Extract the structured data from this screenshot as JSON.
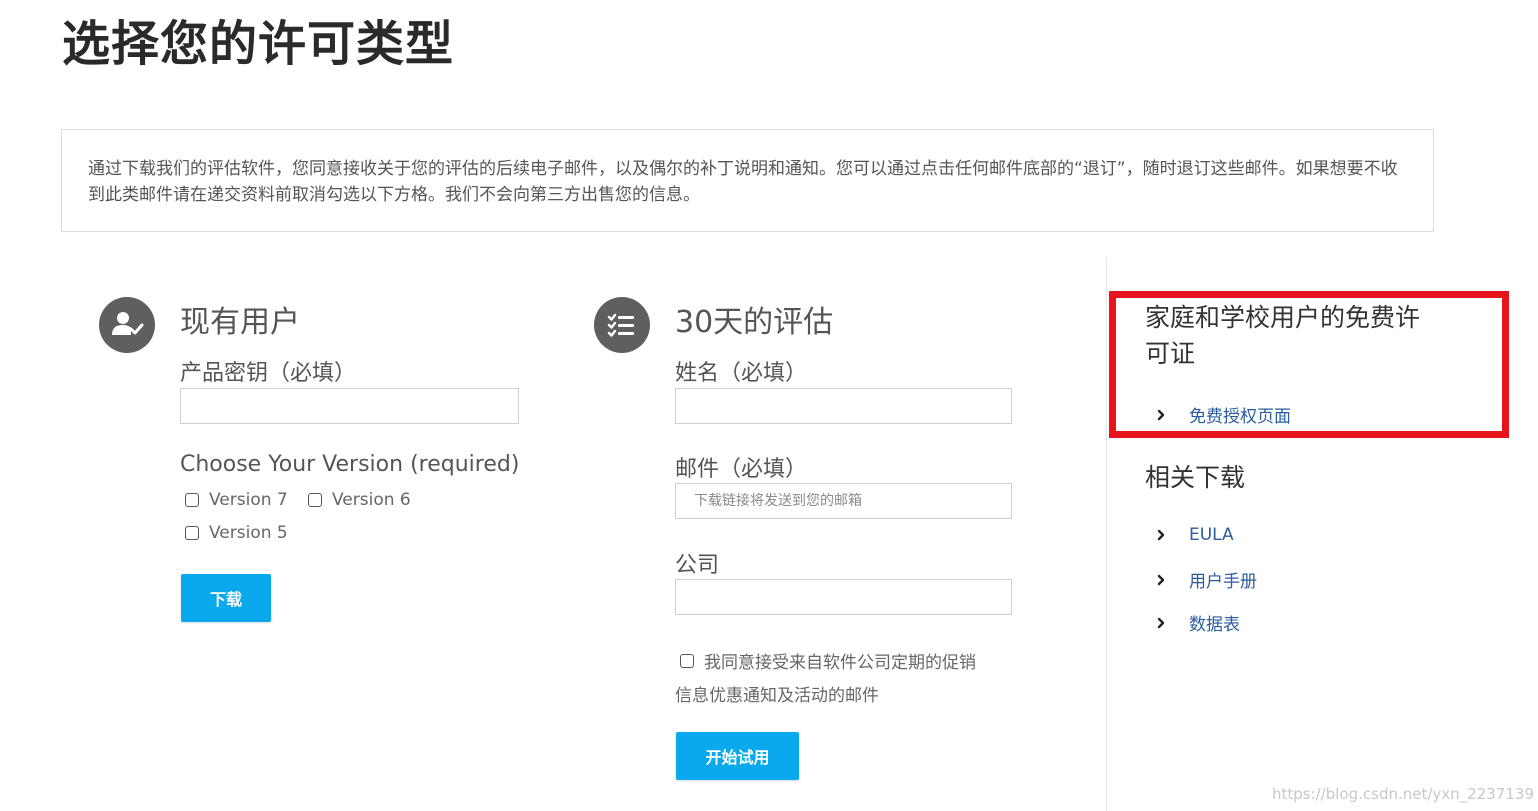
{
  "page": {
    "title": "选择您的许可类型",
    "notice": "通过下载我们的评估软件，您同意接收关于您的评估的后续电子邮件，以及偶尔的补丁说明和通知。您可以通过点击任何邮件底部的“退订”，随时退订这些邮件。如果想要不收到此类邮件请在递交资料前取消勾选以下方格。我们不会向第三方出售您的信息。"
  },
  "existing": {
    "icon": "user-check-icon",
    "title": "现有用户",
    "key_label": "产品密钥（必填）",
    "key_value": "",
    "version_label": "Choose Your Version (required)",
    "versions": [
      "Version 7",
      "Version 6",
      "Version 5"
    ],
    "download_label": "下载"
  },
  "trial": {
    "icon": "checklist-icon",
    "title": "30天的评估",
    "name_label": "姓名（必填）",
    "name_value": "",
    "email_label": "邮件（必填）",
    "email_placeholder": "下载链接将发送到您的邮箱",
    "company_label": "公司",
    "company_value": "",
    "consent_line1": "我同意接受来自软件公司定期的促销",
    "consent_line2": "信息优惠通知及活动的邮件",
    "start_label": "开始试用"
  },
  "sidebar": {
    "free_title_line1": "家庭和学校用户的免费许",
    "free_title_line2": "可证",
    "free_link": "免费授权页面",
    "downloads_title": "相关下载",
    "downloads": [
      "EULA",
      "用户手册",
      "数据表"
    ]
  },
  "watermark": "https://blog.csdn.net/yxn_2237139",
  "colors": {
    "accent": "#0aa9ee",
    "highlight_border": "#e8141c",
    "link": "#2b5c9e"
  }
}
